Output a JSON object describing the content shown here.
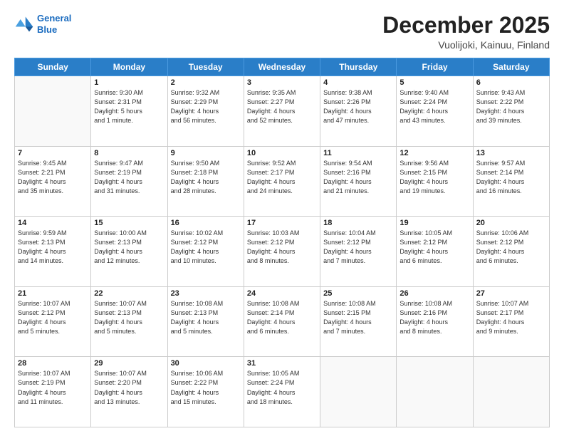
{
  "header": {
    "logo_line1": "General",
    "logo_line2": "Blue",
    "month": "December 2025",
    "location": "Vuolijoki, Kainuu, Finland"
  },
  "weekdays": [
    "Sunday",
    "Monday",
    "Tuesday",
    "Wednesday",
    "Thursday",
    "Friday",
    "Saturday"
  ],
  "weeks": [
    [
      {
        "day": "",
        "info": ""
      },
      {
        "day": "1",
        "info": "Sunrise: 9:30 AM\nSunset: 2:31 PM\nDaylight: 5 hours\nand 1 minute."
      },
      {
        "day": "2",
        "info": "Sunrise: 9:32 AM\nSunset: 2:29 PM\nDaylight: 4 hours\nand 56 minutes."
      },
      {
        "day": "3",
        "info": "Sunrise: 9:35 AM\nSunset: 2:27 PM\nDaylight: 4 hours\nand 52 minutes."
      },
      {
        "day": "4",
        "info": "Sunrise: 9:38 AM\nSunset: 2:26 PM\nDaylight: 4 hours\nand 47 minutes."
      },
      {
        "day": "5",
        "info": "Sunrise: 9:40 AM\nSunset: 2:24 PM\nDaylight: 4 hours\nand 43 minutes."
      },
      {
        "day": "6",
        "info": "Sunrise: 9:43 AM\nSunset: 2:22 PM\nDaylight: 4 hours\nand 39 minutes."
      }
    ],
    [
      {
        "day": "7",
        "info": "Sunrise: 9:45 AM\nSunset: 2:21 PM\nDaylight: 4 hours\nand 35 minutes."
      },
      {
        "day": "8",
        "info": "Sunrise: 9:47 AM\nSunset: 2:19 PM\nDaylight: 4 hours\nand 31 minutes."
      },
      {
        "day": "9",
        "info": "Sunrise: 9:50 AM\nSunset: 2:18 PM\nDaylight: 4 hours\nand 28 minutes."
      },
      {
        "day": "10",
        "info": "Sunrise: 9:52 AM\nSunset: 2:17 PM\nDaylight: 4 hours\nand 24 minutes."
      },
      {
        "day": "11",
        "info": "Sunrise: 9:54 AM\nSunset: 2:16 PM\nDaylight: 4 hours\nand 21 minutes."
      },
      {
        "day": "12",
        "info": "Sunrise: 9:56 AM\nSunset: 2:15 PM\nDaylight: 4 hours\nand 19 minutes."
      },
      {
        "day": "13",
        "info": "Sunrise: 9:57 AM\nSunset: 2:14 PM\nDaylight: 4 hours\nand 16 minutes."
      }
    ],
    [
      {
        "day": "14",
        "info": "Sunrise: 9:59 AM\nSunset: 2:13 PM\nDaylight: 4 hours\nand 14 minutes."
      },
      {
        "day": "15",
        "info": "Sunrise: 10:00 AM\nSunset: 2:13 PM\nDaylight: 4 hours\nand 12 minutes."
      },
      {
        "day": "16",
        "info": "Sunrise: 10:02 AM\nSunset: 2:12 PM\nDaylight: 4 hours\nand 10 minutes."
      },
      {
        "day": "17",
        "info": "Sunrise: 10:03 AM\nSunset: 2:12 PM\nDaylight: 4 hours\nand 8 minutes."
      },
      {
        "day": "18",
        "info": "Sunrise: 10:04 AM\nSunset: 2:12 PM\nDaylight: 4 hours\nand 7 minutes."
      },
      {
        "day": "19",
        "info": "Sunrise: 10:05 AM\nSunset: 2:12 PM\nDaylight: 4 hours\nand 6 minutes."
      },
      {
        "day": "20",
        "info": "Sunrise: 10:06 AM\nSunset: 2:12 PM\nDaylight: 4 hours\nand 6 minutes."
      }
    ],
    [
      {
        "day": "21",
        "info": "Sunrise: 10:07 AM\nSunset: 2:12 PM\nDaylight: 4 hours\nand 5 minutes."
      },
      {
        "day": "22",
        "info": "Sunrise: 10:07 AM\nSunset: 2:13 PM\nDaylight: 4 hours\nand 5 minutes."
      },
      {
        "day": "23",
        "info": "Sunrise: 10:08 AM\nSunset: 2:13 PM\nDaylight: 4 hours\nand 5 minutes."
      },
      {
        "day": "24",
        "info": "Sunrise: 10:08 AM\nSunset: 2:14 PM\nDaylight: 4 hours\nand 6 minutes."
      },
      {
        "day": "25",
        "info": "Sunrise: 10:08 AM\nSunset: 2:15 PM\nDaylight: 4 hours\nand 7 minutes."
      },
      {
        "day": "26",
        "info": "Sunrise: 10:08 AM\nSunset: 2:16 PM\nDaylight: 4 hours\nand 8 minutes."
      },
      {
        "day": "27",
        "info": "Sunrise: 10:07 AM\nSunset: 2:17 PM\nDaylight: 4 hours\nand 9 minutes."
      }
    ],
    [
      {
        "day": "28",
        "info": "Sunrise: 10:07 AM\nSunset: 2:19 PM\nDaylight: 4 hours\nand 11 minutes."
      },
      {
        "day": "29",
        "info": "Sunrise: 10:07 AM\nSunset: 2:20 PM\nDaylight: 4 hours\nand 13 minutes."
      },
      {
        "day": "30",
        "info": "Sunrise: 10:06 AM\nSunset: 2:22 PM\nDaylight: 4 hours\nand 15 minutes."
      },
      {
        "day": "31",
        "info": "Sunrise: 10:05 AM\nSunset: 2:24 PM\nDaylight: 4 hours\nand 18 minutes."
      },
      {
        "day": "",
        "info": ""
      },
      {
        "day": "",
        "info": ""
      },
      {
        "day": "",
        "info": ""
      }
    ]
  ]
}
